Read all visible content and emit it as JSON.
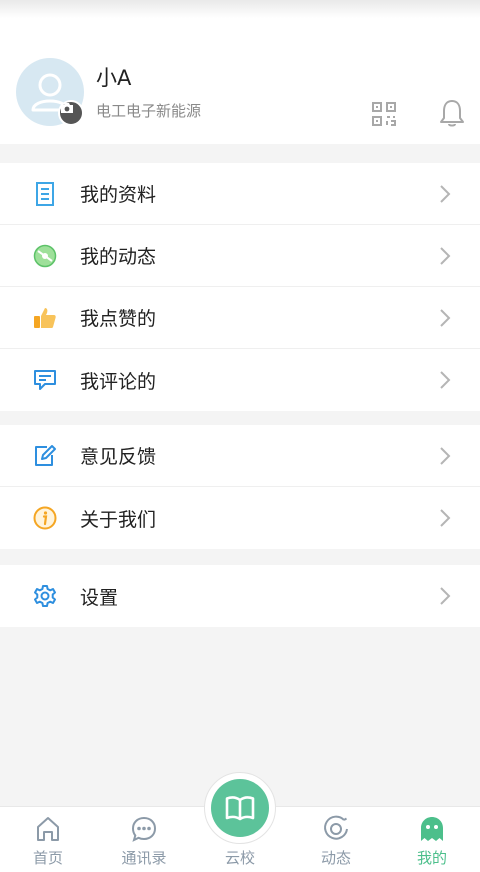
{
  "profile": {
    "name": "小A",
    "organization": "电工电子新能源"
  },
  "menu_groups": [
    {
      "items": [
        {
          "label": "我的资料",
          "icon": "document-icon"
        },
        {
          "label": "我的动态",
          "icon": "compass-icon"
        },
        {
          "label": "我点赞的",
          "icon": "thumbs-up-icon"
        },
        {
          "label": "我评论的",
          "icon": "comment-icon"
        }
      ]
    },
    {
      "items": [
        {
          "label": "意见反馈",
          "icon": "edit-icon"
        },
        {
          "label": "关于我们",
          "icon": "info-icon"
        }
      ]
    },
    {
      "items": [
        {
          "label": "设置",
          "icon": "gear-icon"
        }
      ]
    }
  ],
  "tabbar": {
    "home": "首页",
    "contacts": "通讯录",
    "cloud_school": "云校",
    "moments": "动态",
    "mine": "我的"
  },
  "colors": {
    "accent_green": "#4cbf8b",
    "tab_inactive": "#8c9aa8",
    "background": "#f4f4f4"
  }
}
